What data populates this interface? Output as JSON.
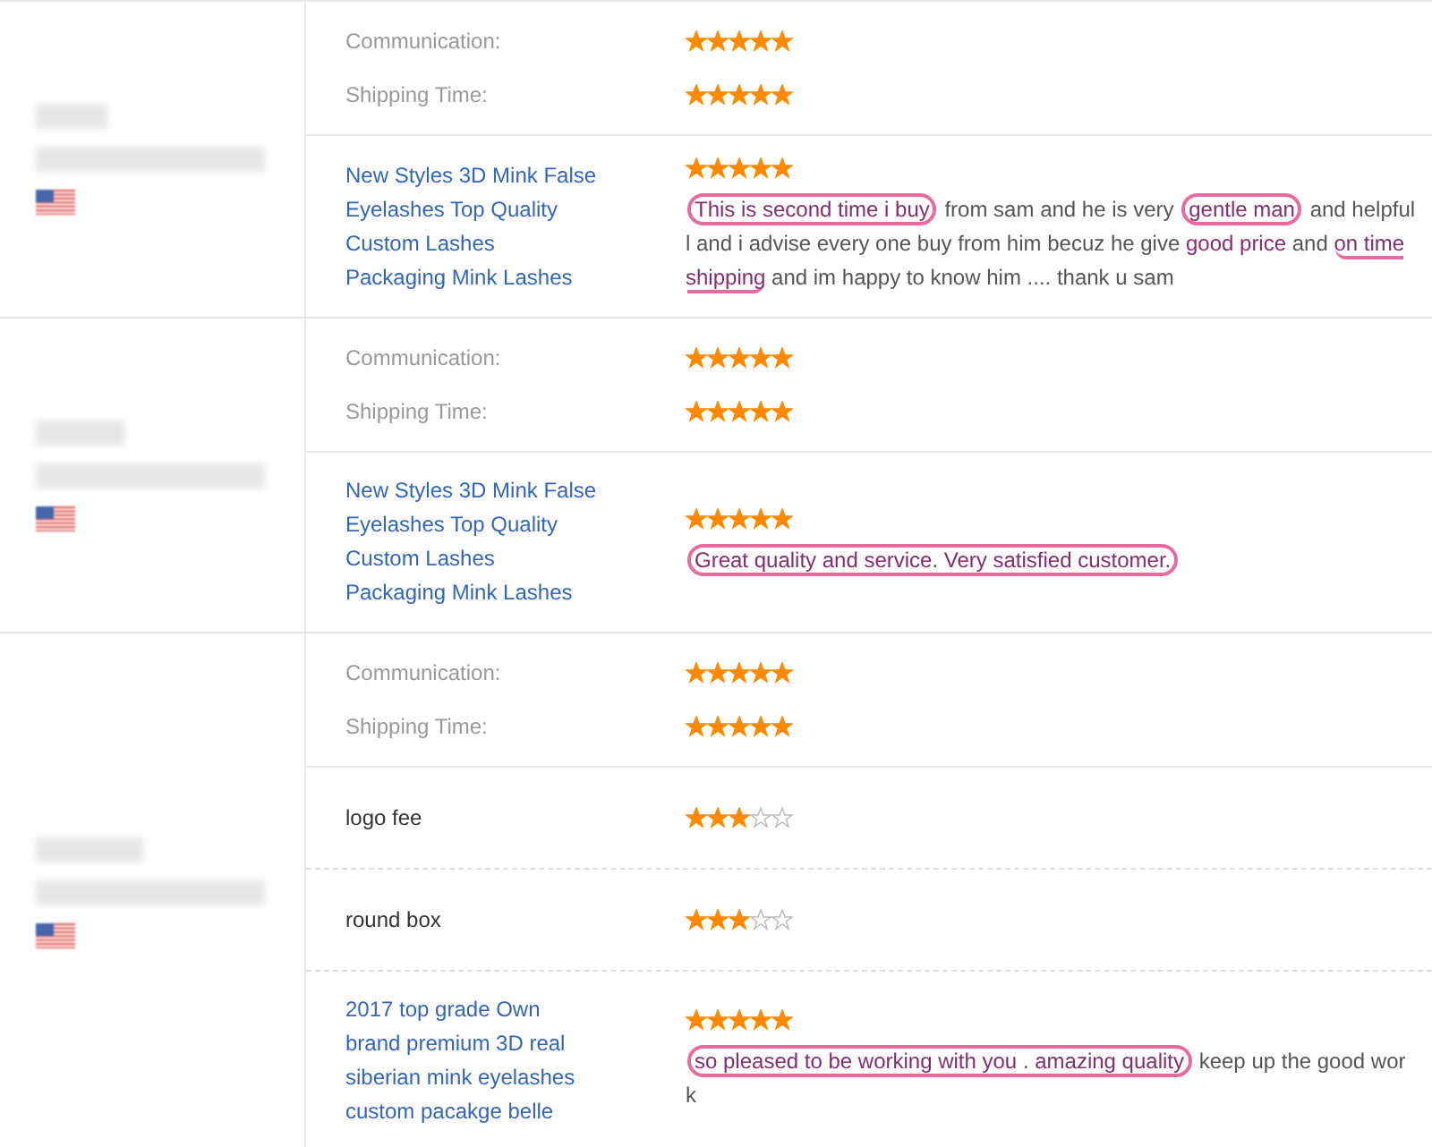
{
  "reviews": [
    {
      "ratings": [
        {
          "label": "Communication:",
          "stars": 5
        },
        {
          "label": "Shipping Time:",
          "stars": 5
        }
      ],
      "items": [
        {
          "kind": "product",
          "name": "New Styles 3D Mink False Eyelashes Top Quality Custom Lashes Packaging Mink Lashes",
          "stars": 5,
          "comment": [
            {
              "kind": "circled",
              "text": "This is second time i buy",
              "highlight": true
            },
            {
              "kind": "plain",
              "text": " from sam and he is very ",
              "highlight": false
            },
            {
              "kind": "circled",
              "text": "gentle man",
              "highlight": true
            },
            {
              "kind": "plain",
              "text": " and helpfull and i advise every one buy from him becuz he give ",
              "highlight": false
            },
            {
              "kind": "plain",
              "text": "good price",
              "highlight": true
            },
            {
              "kind": "plain",
              "text": " and ",
              "highlight": false
            },
            {
              "kind": "underlined",
              "text": "on time shipping",
              "highlight": true
            },
            {
              "kind": "plain",
              "text": " and im happy to know him .... thank u sam",
              "highlight": false
            }
          ]
        }
      ]
    },
    {
      "ratings": [
        {
          "label": "Communication:",
          "stars": 5
        },
        {
          "label": "Shipping Time:",
          "stars": 5
        }
      ],
      "items": [
        {
          "kind": "product",
          "name": "New Styles 3D Mink False Eyelashes Top Quality Custom Lashes Packaging Mink Lashes",
          "stars": 5,
          "comment": [
            {
              "kind": "circled",
              "text": "Great quality and service. Very satisfied customer.",
              "highlight": true
            }
          ]
        }
      ]
    },
    {
      "ratings": [
        {
          "label": "Communication:",
          "stars": 5
        },
        {
          "label": "Shipping Time:",
          "stars": 5
        }
      ],
      "items": [
        {
          "kind": "fee",
          "name": "logo fee",
          "stars": 3
        },
        {
          "kind": "fee",
          "name": "round box",
          "stars": 3
        },
        {
          "kind": "product",
          "name": "2017 top grade Own brand premium 3D real siberian mink eyelashes custom pacakge belle",
          "stars": 5,
          "comment": [
            {
              "kind": "circled",
              "text": "so pleased to be working with you . amazing quality",
              "highlight": true
            },
            {
              "kind": "plain",
              "text": " keep up the good work",
              "highlight": false
            }
          ]
        }
      ]
    }
  ]
}
